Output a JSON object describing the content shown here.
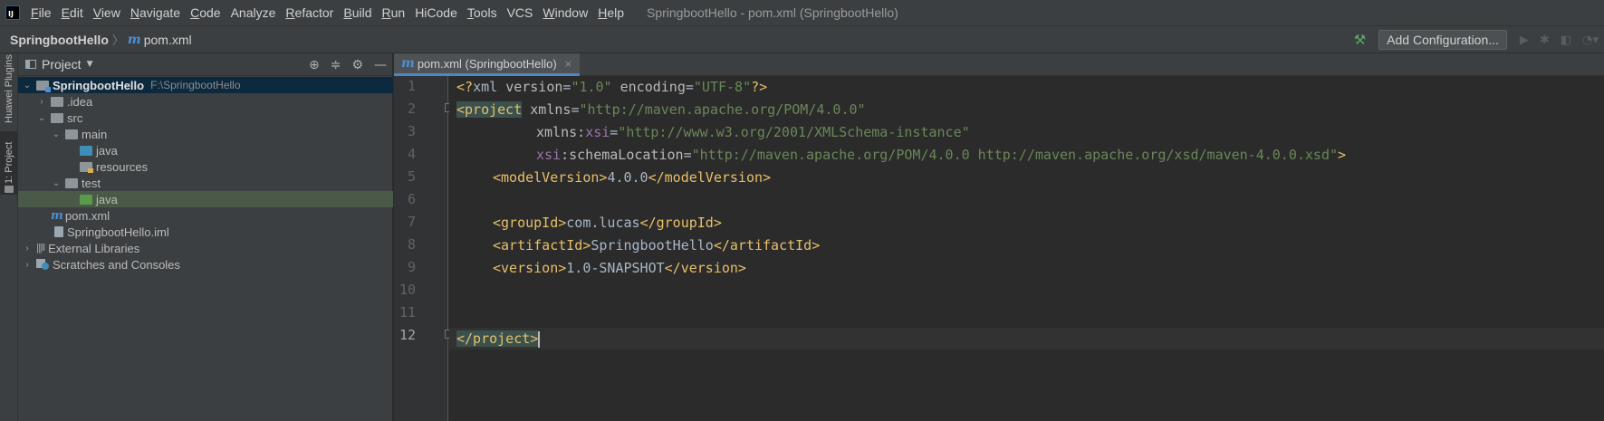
{
  "menu": {
    "logo": "IJ",
    "items": [
      {
        "mnemonic": "F",
        "rest": "ile"
      },
      {
        "mnemonic": "E",
        "rest": "dit"
      },
      {
        "mnemonic": "V",
        "rest": "iew"
      },
      {
        "mnemonic": "N",
        "rest": "avigate"
      },
      {
        "mnemonic": "C",
        "rest": "ode"
      },
      {
        "mnemonic": "",
        "rest": "Analyze"
      },
      {
        "mnemonic": "R",
        "rest": "efactor"
      },
      {
        "mnemonic": "B",
        "rest": "uild"
      },
      {
        "mnemonic": "R",
        "rest": "un"
      },
      {
        "mnemonic": "",
        "rest": "HiCode"
      },
      {
        "mnemonic": "T",
        "rest": "ools"
      },
      {
        "mnemonic": "",
        "rest": "VCS"
      },
      {
        "mnemonic": "W",
        "rest": "indow"
      },
      {
        "mnemonic": "H",
        "rest": "elp"
      }
    ],
    "window_title": "SpringbootHello - pom.xml (SpringbootHello)"
  },
  "navbar": {
    "project": "SpringbootHello",
    "file_icon": "m",
    "file": "pom.xml",
    "add_configuration": "Add Configuration..."
  },
  "left_strip": {
    "huawei_plugins": "Huawei Plugins",
    "project_tab": "1: Project"
  },
  "project_panel": {
    "title": "Project",
    "tree": [
      {
        "label": "SpringbootHello",
        "path": "F:\\SpringbootHello"
      },
      {
        "label": ".idea"
      },
      {
        "label": "src"
      },
      {
        "label": "main"
      },
      {
        "label": "java"
      },
      {
        "label": "resources"
      },
      {
        "label": "test"
      },
      {
        "label": "java"
      },
      {
        "label": "pom.xml",
        "icon": "m"
      },
      {
        "label": "SpringbootHello.iml"
      },
      {
        "label": "External Libraries"
      },
      {
        "label": "Scratches and Consoles"
      }
    ]
  },
  "editor": {
    "tab_icon": "m",
    "tab_label": "pom.xml (SpringbootHello)",
    "tab_close": "×",
    "line_numbers": [
      "1",
      "2",
      "3",
      "4",
      "5",
      "6",
      "7",
      "8",
      "9",
      "10",
      "11",
      "12"
    ],
    "code": {
      "l1": {
        "a": "<?",
        "b": "xml ",
        "c": "version",
        "d": "=",
        "e": "\"1.0\"",
        "f": " encoding",
        "g": "=",
        "h": "\"UTF-8\"",
        "i": "?>"
      },
      "l2": {
        "tag": "<project",
        "attr": " xmlns",
        "eq": "=",
        "val": "\"http://maven.apache.org/POM/4.0.0\""
      },
      "l3": {
        "attr": "xmlns:",
        "ns": "xsi",
        "eq": "=",
        "val": "\"http://www.w3.org/2001/XMLSchema-instance\""
      },
      "l4": {
        "ns": "xsi",
        "attr": ":schemaLocation",
        "eq": "=",
        "val": "\"http://maven.apache.org/POM/4.0.0 http://maven.apache.org/xsd/maven-4.0.0.xsd\"",
        "close": ">"
      },
      "l5": {
        "open": "<modelVersion>",
        "text": "4.0.0",
        "close": "</modelVersion>"
      },
      "l7": {
        "open": "<groupId>",
        "text": "com.lucas",
        "close": "</groupId>"
      },
      "l8": {
        "open": "<artifactId>",
        "text": "SpringbootHello",
        "close": "</artifactId>"
      },
      "l9": {
        "open": "<version>",
        "text": "1.0-SNAPSHOT",
        "close": "</version>"
      },
      "l12": {
        "tag": "</project>"
      }
    }
  },
  "colors": {
    "tag": "#e8bf6a",
    "string": "#6a8759",
    "namespace": "#9876aa",
    "text": "#a9b7c6",
    "accent": "#4a88c7",
    "selection": "#0d293e"
  }
}
